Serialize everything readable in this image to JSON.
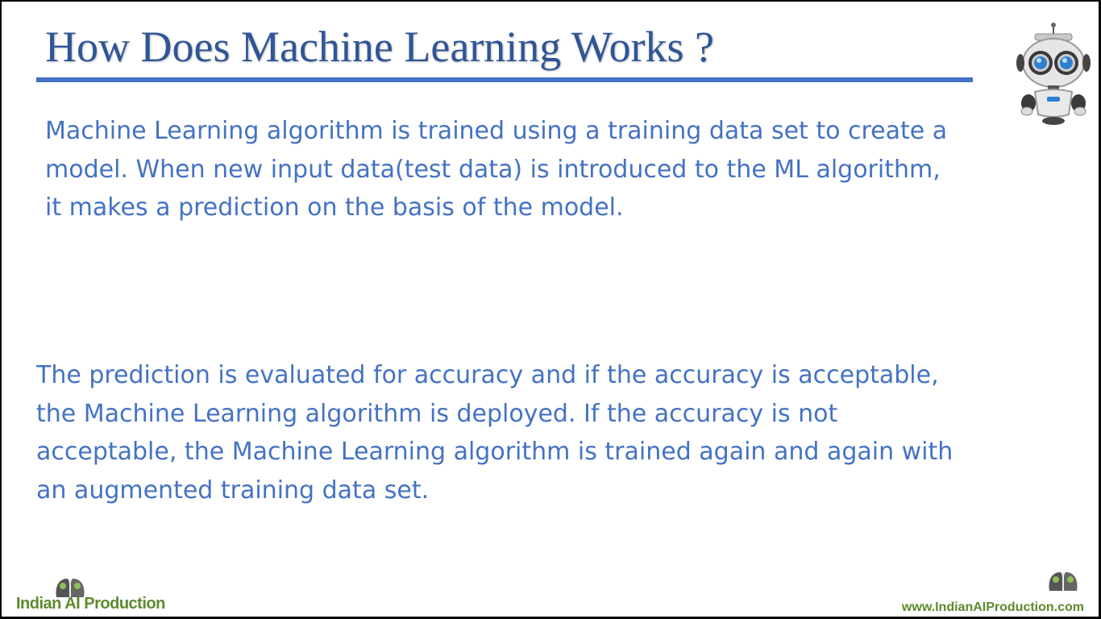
{
  "slide": {
    "title": "How Does Machine Learning Works ?",
    "paragraph_1": "Machine Learning algorithm is trained using a training data set to create a model. When new input data(test data) is introduced to the ML algorithm, it makes a prediction on the basis of the model.",
    "paragraph_2": "The prediction is evaluated for accuracy and if the accuracy is acceptable, the Machine Learning algorithm is deployed. If the accuracy is not acceptable, the Machine Learning algorithm is trained again and again with an augmented training data set."
  },
  "branding": {
    "logo_text": "Indian AI Production",
    "website": "www.IndianAIProduction.com"
  },
  "colors": {
    "title": "#2f5597",
    "rule": "#4472c4",
    "body_text": "#4472c4",
    "brand_green": "#5c8a2d"
  },
  "icons": {
    "robot": "robot-icon",
    "logo": "ai-head-logo-icon"
  }
}
